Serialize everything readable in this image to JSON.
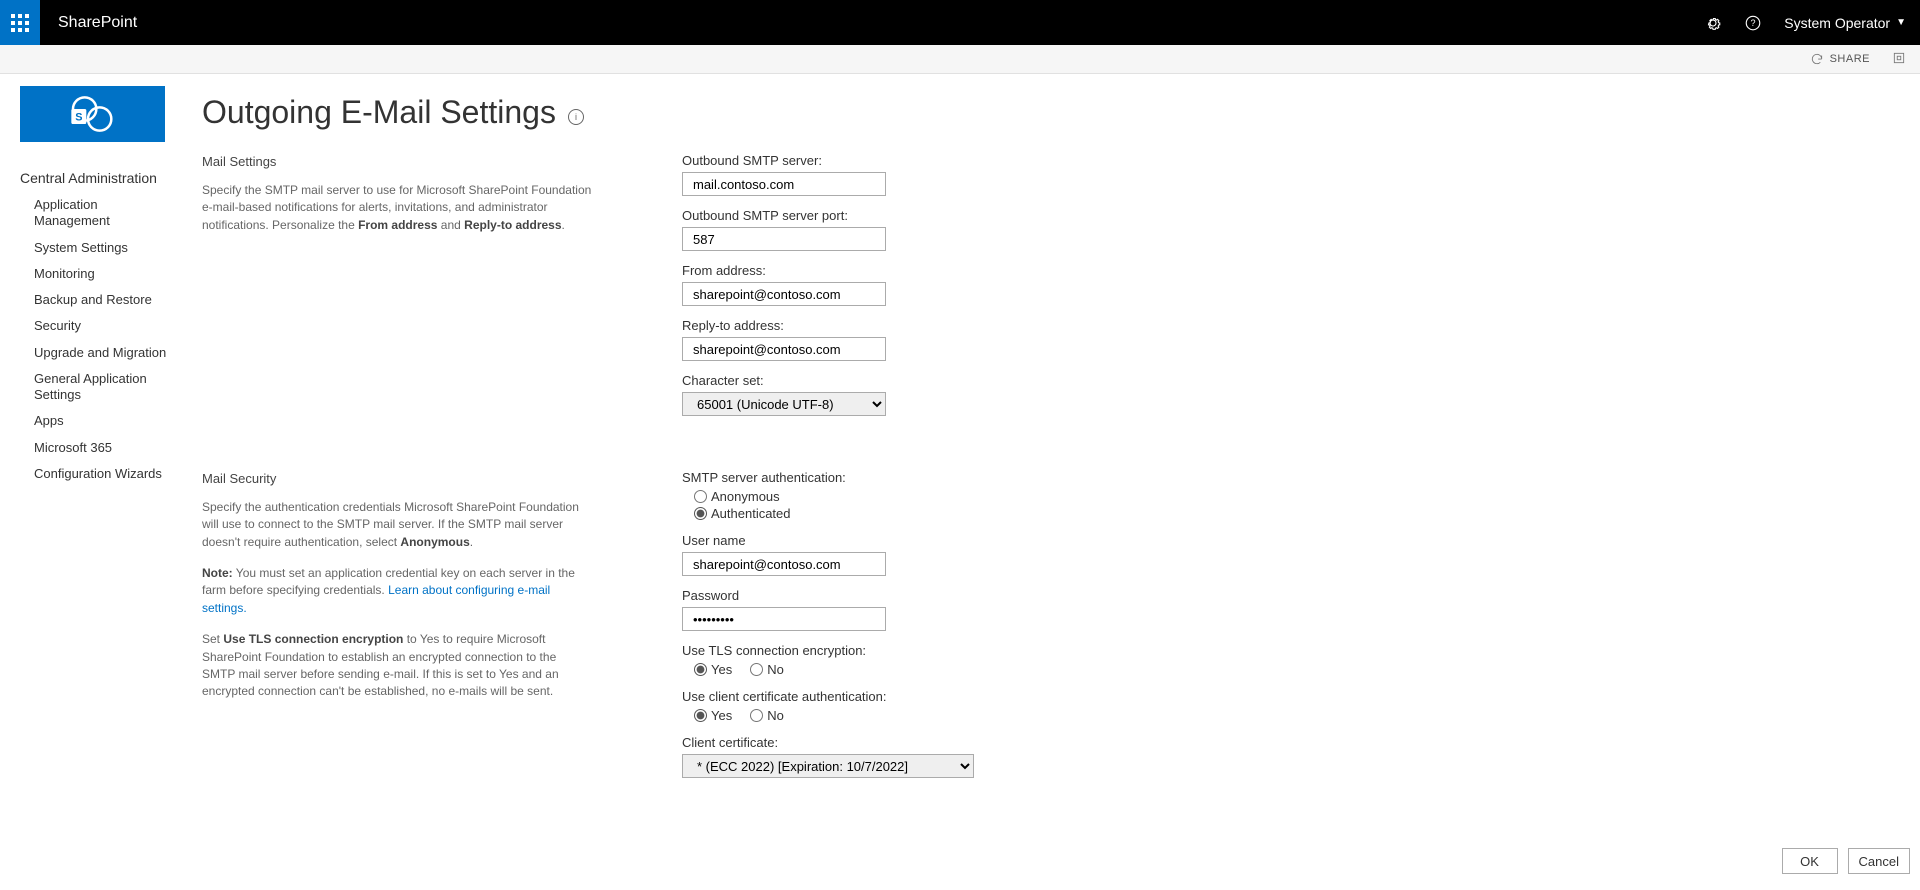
{
  "suite": {
    "app_title": "SharePoint",
    "user_name": "System Operator"
  },
  "ribbon": {
    "share_label": "SHARE"
  },
  "page": {
    "title": "Outgoing E-Mail Settings"
  },
  "nav": {
    "heading": "Central Administration",
    "items": [
      "Application Management",
      "System Settings",
      "Monitoring",
      "Backup and Restore",
      "Security",
      "Upgrade and Migration",
      "General Application Settings",
      "Apps",
      "Microsoft 365",
      "Configuration Wizards"
    ]
  },
  "sections": {
    "mail_settings": {
      "heading": "Mail Settings",
      "desc_pre": "Specify the SMTP mail server to use for Microsoft SharePoint Foundation e-mail-based notifications for alerts, invitations, and administrator notifications.  Personalize the ",
      "desc_b1": "From address",
      "desc_mid": " and ",
      "desc_b2": "Reply-to address",
      "desc_post": "."
    },
    "mail_security": {
      "heading": "Mail Security",
      "p1": "Specify the authentication credentials Microsoft SharePoint Foundation will use to connect to the SMTP mail server. If the SMTP mail server doesn't require authentication, select ",
      "p1_b": "Anonymous",
      "p1_post": ".",
      "p2_b": "Note:",
      "p2_after": " You must set an application credential key on each server in the farm before specifying credentials. ",
      "p2_link": "Learn about configuring e-mail settings.",
      "p3_pre": "Set ",
      "p3_b": "Use TLS connection encryption",
      "p3_after": " to Yes to require Microsoft SharePoint Foundation to establish an encrypted connection to the SMTP mail server before sending e-mail. If this is set to Yes and an encrypted connection can't be established, no e-mails will be sent."
    }
  },
  "fields": {
    "outbound_server_label": "Outbound SMTP server:",
    "outbound_server_value": "mail.contoso.com",
    "outbound_port_label": "Outbound SMTP server port:",
    "outbound_port_value": "587",
    "from_label": "From address:",
    "from_value": "sharepoint@contoso.com",
    "replyto_label": "Reply-to address:",
    "replyto_value": "sharepoint@contoso.com",
    "charset_label": "Character set:",
    "charset_value": "65001 (Unicode UTF-8)",
    "auth_label": "SMTP server authentication:",
    "auth_anonymous": "Anonymous",
    "auth_authenticated": "Authenticated",
    "username_label": "User name",
    "username_value": "sharepoint@contoso.com",
    "password_label": "Password",
    "password_value": "•••••••••",
    "tls_label": "Use TLS connection encryption:",
    "clientcertauth_label": "Use client certificate authentication:",
    "yes": "Yes",
    "no": "No",
    "clientcert_label": "Client certificate:",
    "clientcert_value": "*                   (ECC 2022) [Expiration: 10/7/2022]"
  },
  "footer": {
    "ok": "OK",
    "cancel": "Cancel"
  }
}
